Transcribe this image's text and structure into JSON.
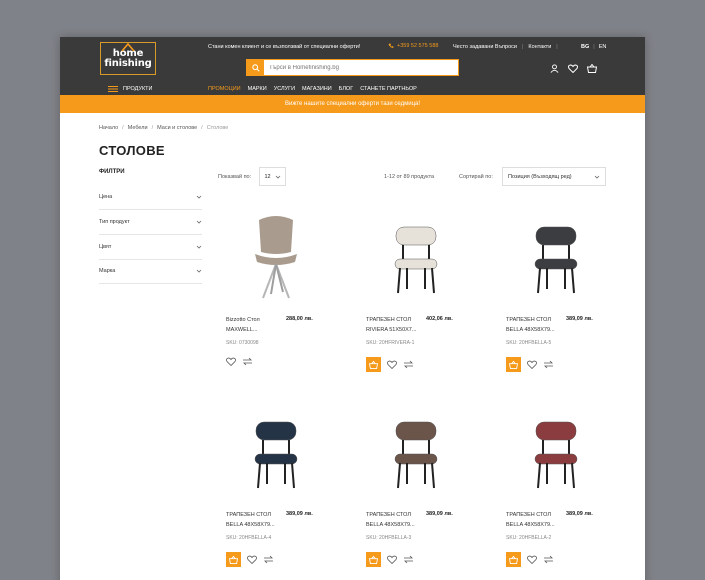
{
  "header": {
    "logo_line1": "home",
    "logo_line2": "finishing",
    "top_message": "Стани комен клиент и се възползвай от специални оферти!",
    "phone": "+359 52 575 588",
    "links": [
      "Често задавани Въпроси",
      "Контакти"
    ],
    "lang": [
      "BG",
      "EN"
    ],
    "search_placeholder": "Търси в Homefinishing.bg",
    "products_menu": "ПРОДУКТИ",
    "menu": [
      "ПРОМОЦИИ",
      "МАРКИ",
      "УСЛУГИ",
      "МАГАЗИНИ",
      "БЛОГ",
      "СТАНЕТЕ ПАРТНЬОР"
    ]
  },
  "banner": "Вижте нашите специални оферти тази седмица!",
  "breadcrumb": [
    "Начало",
    "Мебели",
    "Маси и столове",
    "Столове"
  ],
  "page_title": "СТОЛОВЕ",
  "filters": {
    "title": "ФИЛТРИ",
    "items": [
      "Цена",
      "Тип продукт",
      "Цвят",
      "Марка"
    ]
  },
  "toolbar": {
    "per_page_label": "Показвай по:",
    "per_page_value": "12",
    "count": "1-12 от 89 продукта",
    "sort_label": "Сортирай по:",
    "sort_value": "Позиция (Възходящ ред)"
  },
  "products": [
    {
      "name": "Bizzotto Стол MAXWELL...",
      "price": "288,00 лв.",
      "sku": "SKU: 0730098",
      "cart": false,
      "color": "#a99c8e"
    },
    {
      "name": "ТРАПЕЗЕН СТОЛ RIVIERA 51X50X7...",
      "price": "402,06 лв.",
      "sku": "SKU: 20HFRIVERA-1",
      "cart": true,
      "color": "#e6e2da"
    },
    {
      "name": "ТРАПЕЗЕН СТОЛ BELLA 48X58X79...",
      "price": "389,09 лв.",
      "sku": "SKU: 20HFBELLA-5",
      "cart": true,
      "color": "#3b3d40"
    },
    {
      "name": "ТРАПЕЗЕН СТОЛ BELLA 48X58X79...",
      "price": "389,09 лв.",
      "sku": "SKU: 20HFBELLA-4",
      "cart": true,
      "color": "#243446"
    },
    {
      "name": "ТРАПЕЗЕН СТОЛ BELLA 48X58X79...",
      "price": "389,09 лв.",
      "sku": "SKU: 20HFBELLA-3",
      "cart": true,
      "color": "#6b5449"
    },
    {
      "name": "ТРАПЕЗЕН СТОЛ BELLA 48X58X79...",
      "price": "389,09 лв.",
      "sku": "SKU: 20HFBELLA-2",
      "cart": true,
      "color": "#8a3c3e"
    }
  ],
  "colors": {
    "accent": "#f59a1b",
    "header_bg": "#3a3a3a"
  }
}
